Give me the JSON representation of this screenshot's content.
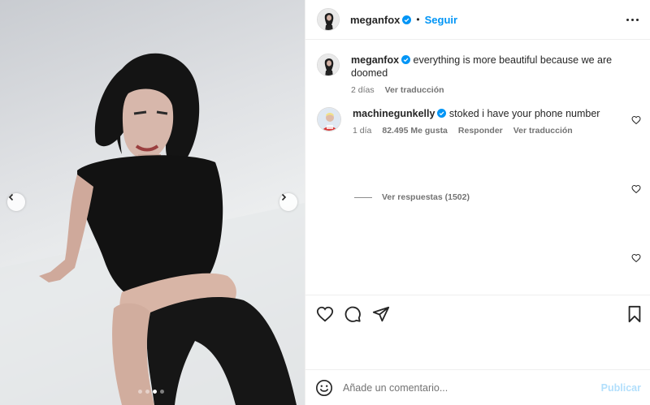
{
  "post": {
    "author": "meganfox",
    "follow_label": "Seguir",
    "separator": "•"
  },
  "carousel": {
    "slide_count": 4,
    "active_slide": 3
  },
  "comments": [
    {
      "username": "meganfox",
      "text": "everything is more beautiful because we are doomed",
      "age": "2 días",
      "translate": "Ver traducción"
    },
    {
      "username": "machinegunkelly",
      "text": "stoked i have your phone number",
      "age": "1 día",
      "likes": "82.495 Me gusta",
      "reply": "Responder",
      "translate": "Ver traducción",
      "view_replies": "Ver respuestas (1502)"
    }
  ],
  "composer": {
    "placeholder": "Añade un comentario...",
    "publish_label": "Publicar"
  },
  "colors": {
    "accent": "#0095f6",
    "publish_disabled": "#b2dffc",
    "verified": "#0095f6"
  }
}
